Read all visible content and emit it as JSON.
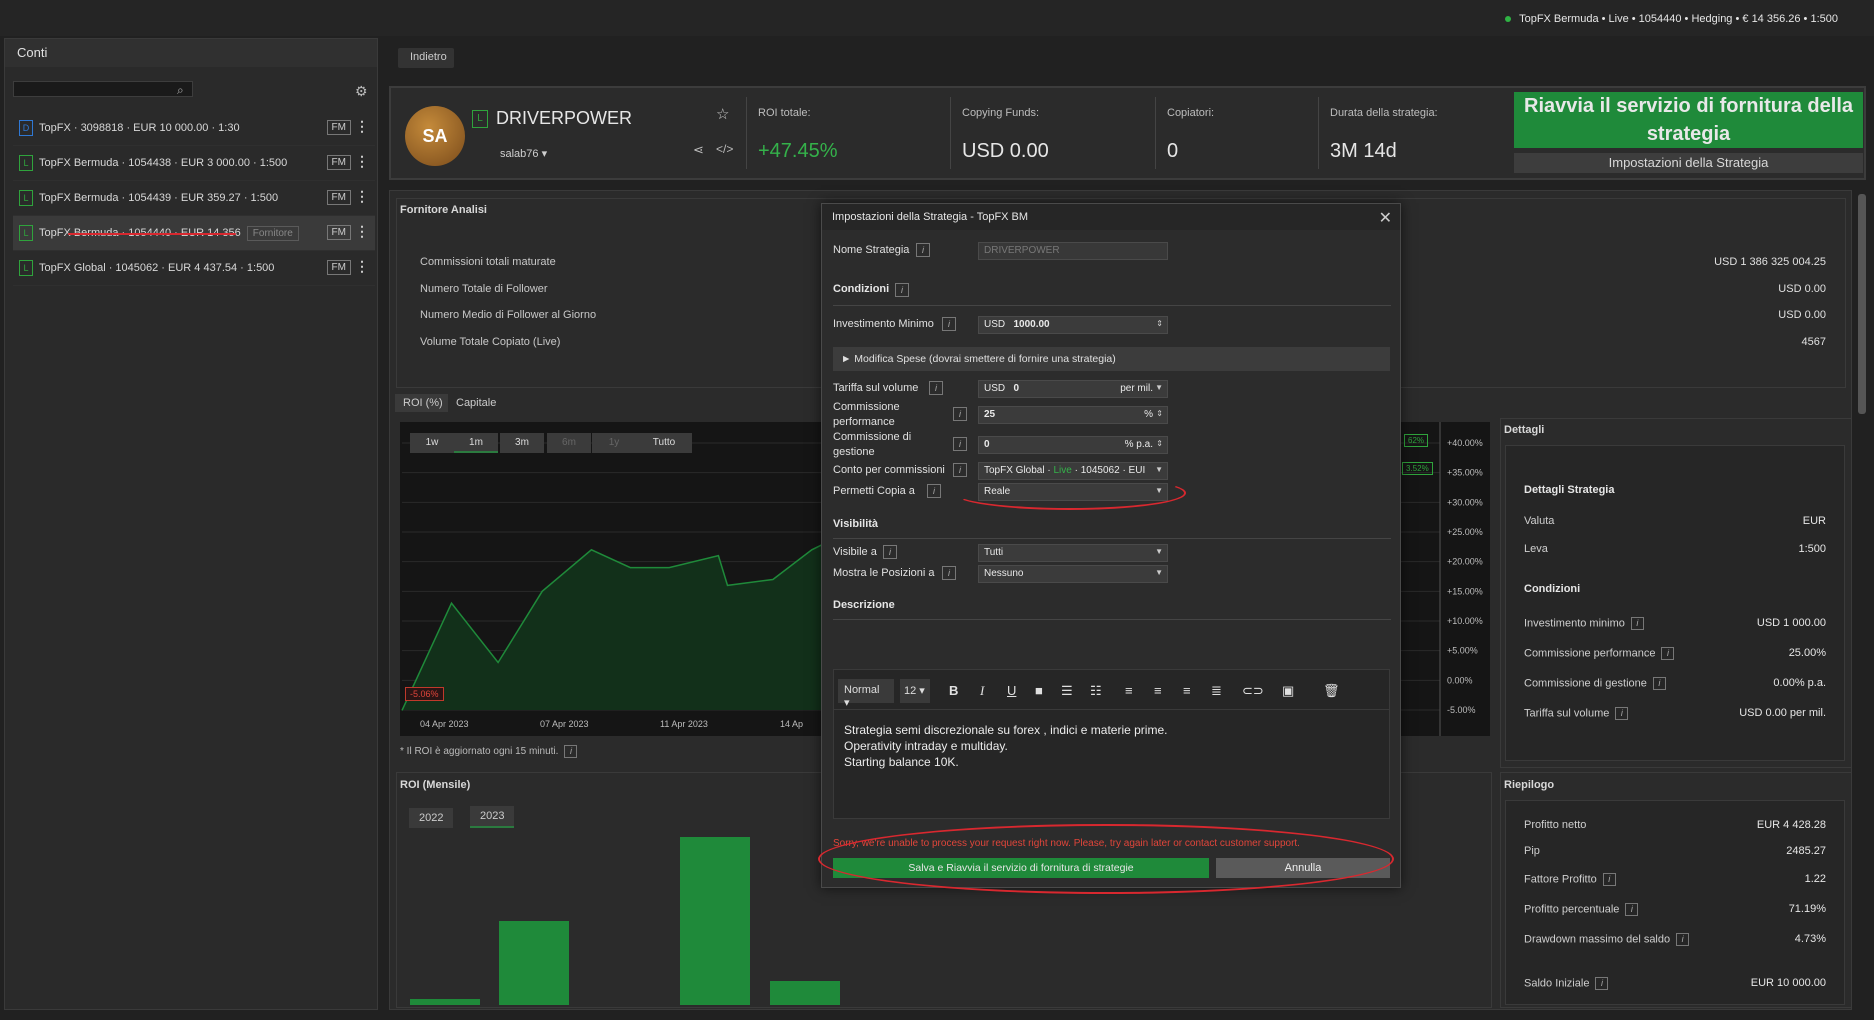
{
  "topbar": {
    "account_status": "TopFX Bermuda • Live • 1054440 • Hedging • € 14 356.26 • 1:500"
  },
  "left_panel": {
    "title": "Conti",
    "accounts": [
      {
        "type": "D",
        "label": "TopFX · 3098818 · EUR 10 000.00 · 1:30",
        "fm": "FM",
        "tag": ""
      },
      {
        "type": "L",
        "label": "TopFX Bermuda · 1054438 · EUR 3 000.00 · 1:500",
        "fm": "FM",
        "tag": ""
      },
      {
        "type": "L",
        "label": "TopFX Bermuda · 1054439 · EUR 359.27 · 1:500",
        "fm": "FM",
        "tag": ""
      },
      {
        "type": "L",
        "label": "TopFX Bermuda · 1054440 · EUR 14 356",
        "fm": "FM",
        "tag": "Fornitore"
      },
      {
        "type": "L",
        "label": "TopFX Global · 1045062 · EUR 4 437.54 · 1:500",
        "fm": "FM",
        "tag": ""
      }
    ]
  },
  "breadcrumb": {
    "back": "Indietro"
  },
  "strategy": {
    "avatar": "SA",
    "badge": "L",
    "name": "DRIVERPOWER",
    "user": "salab76 ▾",
    "roi_label": "ROI totale:",
    "roi_value": "+47.45%",
    "funds_label": "Copying Funds:",
    "funds_value": "USD 0.00",
    "copiers_label": "Copiatori:",
    "copiers_value": "0",
    "duration_label": "Durata della strategia:",
    "duration_value": "3M 14d",
    "restart_button": "Riavvia il servizio di fornitura della strategia",
    "settings_button": "Impostazioni della Strategia"
  },
  "analisi": {
    "title": "Fornitore Analisi",
    "rows": [
      {
        "label": "Commissioni totali maturate",
        "value": "USD 1 386 325 004.25"
      },
      {
        "label": "Numero Totale di Follower",
        "value": "USD 0.00"
      },
      {
        "label": "Numero Medio di Follower al Giorno",
        "value": "USD 0.00"
      },
      {
        "label": "Volume Totale Copiato (Live)",
        "value": "4567"
      }
    ]
  },
  "roi_chart": {
    "tabs": [
      "ROI (%)",
      "Capitale"
    ],
    "ranges": [
      "1w",
      "1m",
      "3m",
      "6m",
      "1y",
      "Tutto"
    ],
    "note": "* Il ROI è aggiornato ogni 15 minuti.",
    "min_label": "-5.06%",
    "right_labels": [
      "62%",
      "3.52%"
    ]
  },
  "chart_data": {
    "type": "area",
    "x_tick_labels": [
      "04 Apr 2023",
      "07 Apr 2023",
      "11 Apr 2023",
      "14 Ap"
    ],
    "y_tick_labels": [
      "+40.00%",
      "+35.00%",
      "+30.00%",
      "+25.00%",
      "+20.00%",
      "+15.00%",
      "+10.00%",
      "+5.00%",
      "0.00%",
      "-5.00%"
    ],
    "ylim": [
      -5,
      40
    ],
    "values": [
      -5.06,
      13,
      3,
      15,
      22,
      19,
      19,
      21,
      16,
      17,
      22,
      26,
      26,
      26,
      26,
      26
    ],
    "grid": true
  },
  "roi_mensile": {
    "title": "ROI (Mensile)",
    "years": [
      "2022",
      "2023"
    ],
    "bar_values": [
      1,
      14,
      0,
      28,
      4
    ]
  },
  "dettagli": {
    "title": "Dettagli",
    "strategy_head": "Dettagli Strategia",
    "valuta_label": "Valuta",
    "valuta_value": "EUR",
    "leva_label": "Leva",
    "leva_value": "1:500",
    "condizioni_head": "Condizioni",
    "rows": [
      {
        "label": "Investimento minimo",
        "value": "USD 1 000.00"
      },
      {
        "label": "Commissione performance",
        "value": "25.00%"
      },
      {
        "label": "Commissione di gestione",
        "value": "0.00% p.a."
      },
      {
        "label": "Tariffa sul volume",
        "value": "USD 0.00 per mil."
      }
    ]
  },
  "riepilogo": {
    "title": "Riepilogo",
    "rows": [
      {
        "label": "Profitto netto",
        "value": "EUR 4 428.28",
        "info": false
      },
      {
        "label": "Pip",
        "value": "2485.27",
        "info": false
      },
      {
        "label": "Fattore Profitto",
        "value": "1.22",
        "info": true
      },
      {
        "label": "Profitto percentuale",
        "value": "71.19%",
        "info": true
      },
      {
        "label": "Drawdown massimo del saldo",
        "value": "4.73%",
        "info": true
      },
      {
        "label": "Saldo Iniziale",
        "value": "EUR 10 000.00",
        "info": true
      }
    ]
  },
  "modal": {
    "title": "Impostazioni della Strategia - TopFX BM",
    "nome_label": "Nome Strategia",
    "nome_value": "DRIVERPOWER",
    "condizioni": "Condizioni",
    "inv_label": "Investimento Minimo",
    "inv_currency": "USD",
    "inv_value": "1000.00",
    "expander": "► Modifica Spese (dovrai smettere di fornire una strategia)",
    "tariffa_label": "Tariffa sul volume",
    "tariffa_currency": "USD",
    "tariffa_value": "0",
    "tariffa_unit": "per mil.",
    "perf_label": "Commissione performance",
    "perf_value": "25",
    "perf_unit": "%",
    "gest_label": "Commissione di gestione",
    "gest_value": "0",
    "gest_unit": "% p.a.",
    "conto_label": "Conto per commissioni",
    "conto_value_a": "TopFX Global · ",
    "conto_value_live": "Live",
    "conto_value_b": " · 1045062 · EUI",
    "permetti_label": "Permetti Copia a",
    "permetti_value": "Reale",
    "visibilita": "Visibilità",
    "visibile_label": "Visibile a",
    "visibile_value": "Tutti",
    "posizioni_label": "Mostra le Posizioni a",
    "posizioni_value": "Nessuno",
    "descrizione": "Descrizione",
    "editor_style": "Normal",
    "editor_size": "12",
    "desc_lines": [
      "Strategia semi discrezionale su forex , indici e materie prime.",
      "Operativity intraday e multiday.",
      "Starting balance 10K."
    ],
    "error": "Sorry, we're unable to process your request right now. Please, try again later or contact customer support.",
    "save_button": "Salva e Riavvia il servizio di fornitura di strategie",
    "cancel_button": "Annulla"
  }
}
